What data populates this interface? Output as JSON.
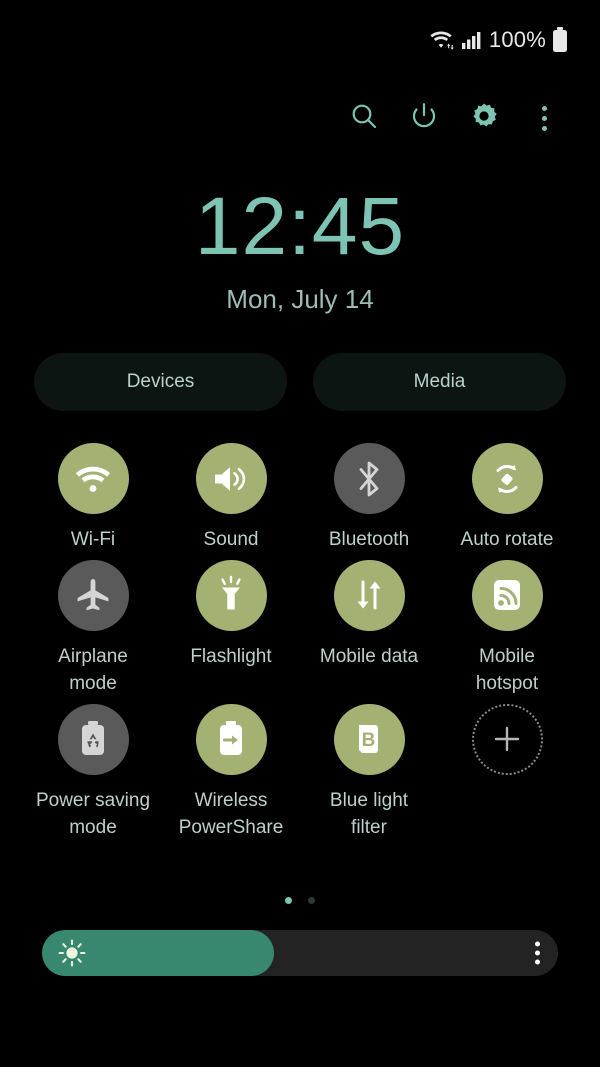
{
  "statusbar": {
    "wifi_icon": "wifi-transfer-icon",
    "signal_icon": "cellular-signal-icon",
    "battery_text": "100%",
    "battery_icon": "battery-full-icon"
  },
  "toolbar": {
    "search_label": "search-icon",
    "power_label": "power-icon",
    "settings_label": "gear-icon",
    "more_label": "overflow-menu-icon"
  },
  "clock": {
    "time": "12:45",
    "date": "Mon, July 14"
  },
  "shortcuts": {
    "devices_label": "Devices",
    "media_label": "Media"
  },
  "tiles": [
    {
      "label": "Wi-Fi",
      "icon": "wifi-icon",
      "state": "on"
    },
    {
      "label": "Sound",
      "icon": "volume-icon",
      "state": "on"
    },
    {
      "label": "Bluetooth",
      "icon": "bluetooth-icon",
      "state": "off"
    },
    {
      "label": "Auto rotate",
      "icon": "auto-rotate-icon",
      "state": "on"
    },
    {
      "label": "Airplane mode",
      "icon": "airplane-icon",
      "state": "off"
    },
    {
      "label": "Flashlight",
      "icon": "flashlight-icon",
      "state": "on"
    },
    {
      "label": "Mobile data",
      "icon": "data-transfer-icon",
      "state": "on"
    },
    {
      "label": "Mobile hotspot",
      "icon": "hotspot-icon",
      "state": "on"
    },
    {
      "label": "Power saving mode",
      "icon": "battery-saver-icon",
      "state": "off"
    },
    {
      "label": "Wireless PowerShare",
      "icon": "powershare-icon",
      "state": "on"
    },
    {
      "label": "Blue light filter",
      "icon": "blue-light-icon",
      "state": "on"
    },
    {
      "label": "",
      "icon": "add-icon",
      "state": "add"
    }
  ],
  "pager": {
    "count": 2,
    "active": 0
  },
  "brightness": {
    "percent": 45,
    "icon": "brightness-sun-icon",
    "menu_icon": "overflow-menu-icon"
  },
  "colors": {
    "background": "#000000",
    "accent_teal": "#7ec4b4",
    "tile_on": "#a3b173",
    "tile_off": "#5a5a5a",
    "label": "#bcd0cc",
    "slider_fill": "#388870",
    "slider_track": "#232323",
    "chip_bg": "#0d1512"
  }
}
